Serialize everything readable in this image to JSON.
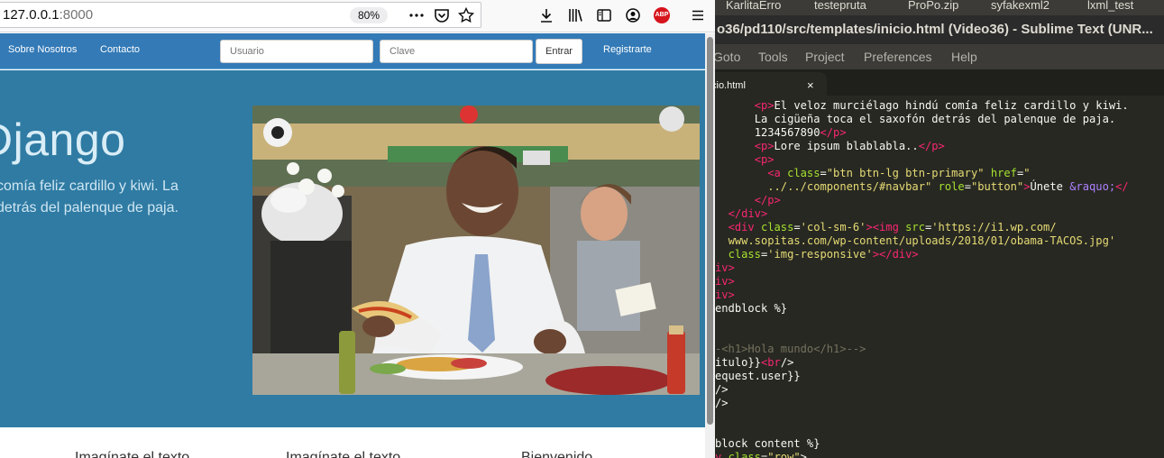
{
  "browser": {
    "url_host": "127.0.0.1",
    "url_port": ":8000",
    "zoom": "80%",
    "abp_label": "ABP",
    "toolbar_icons": [
      "more-dots-icon",
      "pocket-icon",
      "bookmark-star-icon",
      "download-icon",
      "library-icon",
      "sidebar-icon",
      "account-icon",
      "adblock-plus-icon",
      "hamburger-menu-icon"
    ]
  },
  "site": {
    "nav": {
      "about": "Sobre Nosotros",
      "contact": "Contacto",
      "user_placeholder": "Usuario",
      "password_placeholder": "Clave",
      "login_button": "Entrar",
      "register": "Registrarte"
    },
    "jumbotron": {
      "title": "Django",
      "line1": "comía feliz cardillo y kiwi. La",
      "line2": "detrás del palenque de paja."
    },
    "features": [
      "Imagínate el texto",
      "Imagínate el texto",
      "Bienvenido"
    ]
  },
  "editor": {
    "os_tabs": [
      "KarlitaErro",
      "testepruta",
      "ProPo.zip",
      "syfakexml2",
      "lxml_test"
    ],
    "title": "o36/pd110/src/templates/inicio.html (Video36) - Sublime Text (UNR...",
    "menu": [
      "Goto",
      "Tools",
      "Project",
      "Preferences",
      "Help"
    ],
    "tab_label": "cio.html",
    "tab_close": "×"
  },
  "code": {
    "l01": "El veloz murciélago hindú comía feliz cardillo y kiwi.",
    "l02": "La cigüeña toca el saxofón detrás del palenque de paja.",
    "l03": "1234567890",
    "l04": "Lore ipsum blablabla..",
    "l06_class": "\"btn btn-lg btn-primary\"",
    "l06_href": "\"",
    "l07_href": "../../components/#navbar\"",
    "l07_role": "\"button\"",
    "l07_text": "Únete ",
    "l07_ent": "&raquo;",
    "l10_class": "'col-sm-6'",
    "l10_src": "'https://i1.wp.com/",
    "l11_src": "www.sopitas.com/wp-content/uploads/2018/01/obama-TACOS.jpg'",
    "l12_class": "'img-responsive'",
    "l16": "endblock %}",
    "l18_comment": "-<h1>Hola mundo</h1>-->",
    "l19_text": "itulo}}",
    "l20": "equest.user}}",
    "l25": "block content %}",
    "l26_class": "\"row\""
  }
}
